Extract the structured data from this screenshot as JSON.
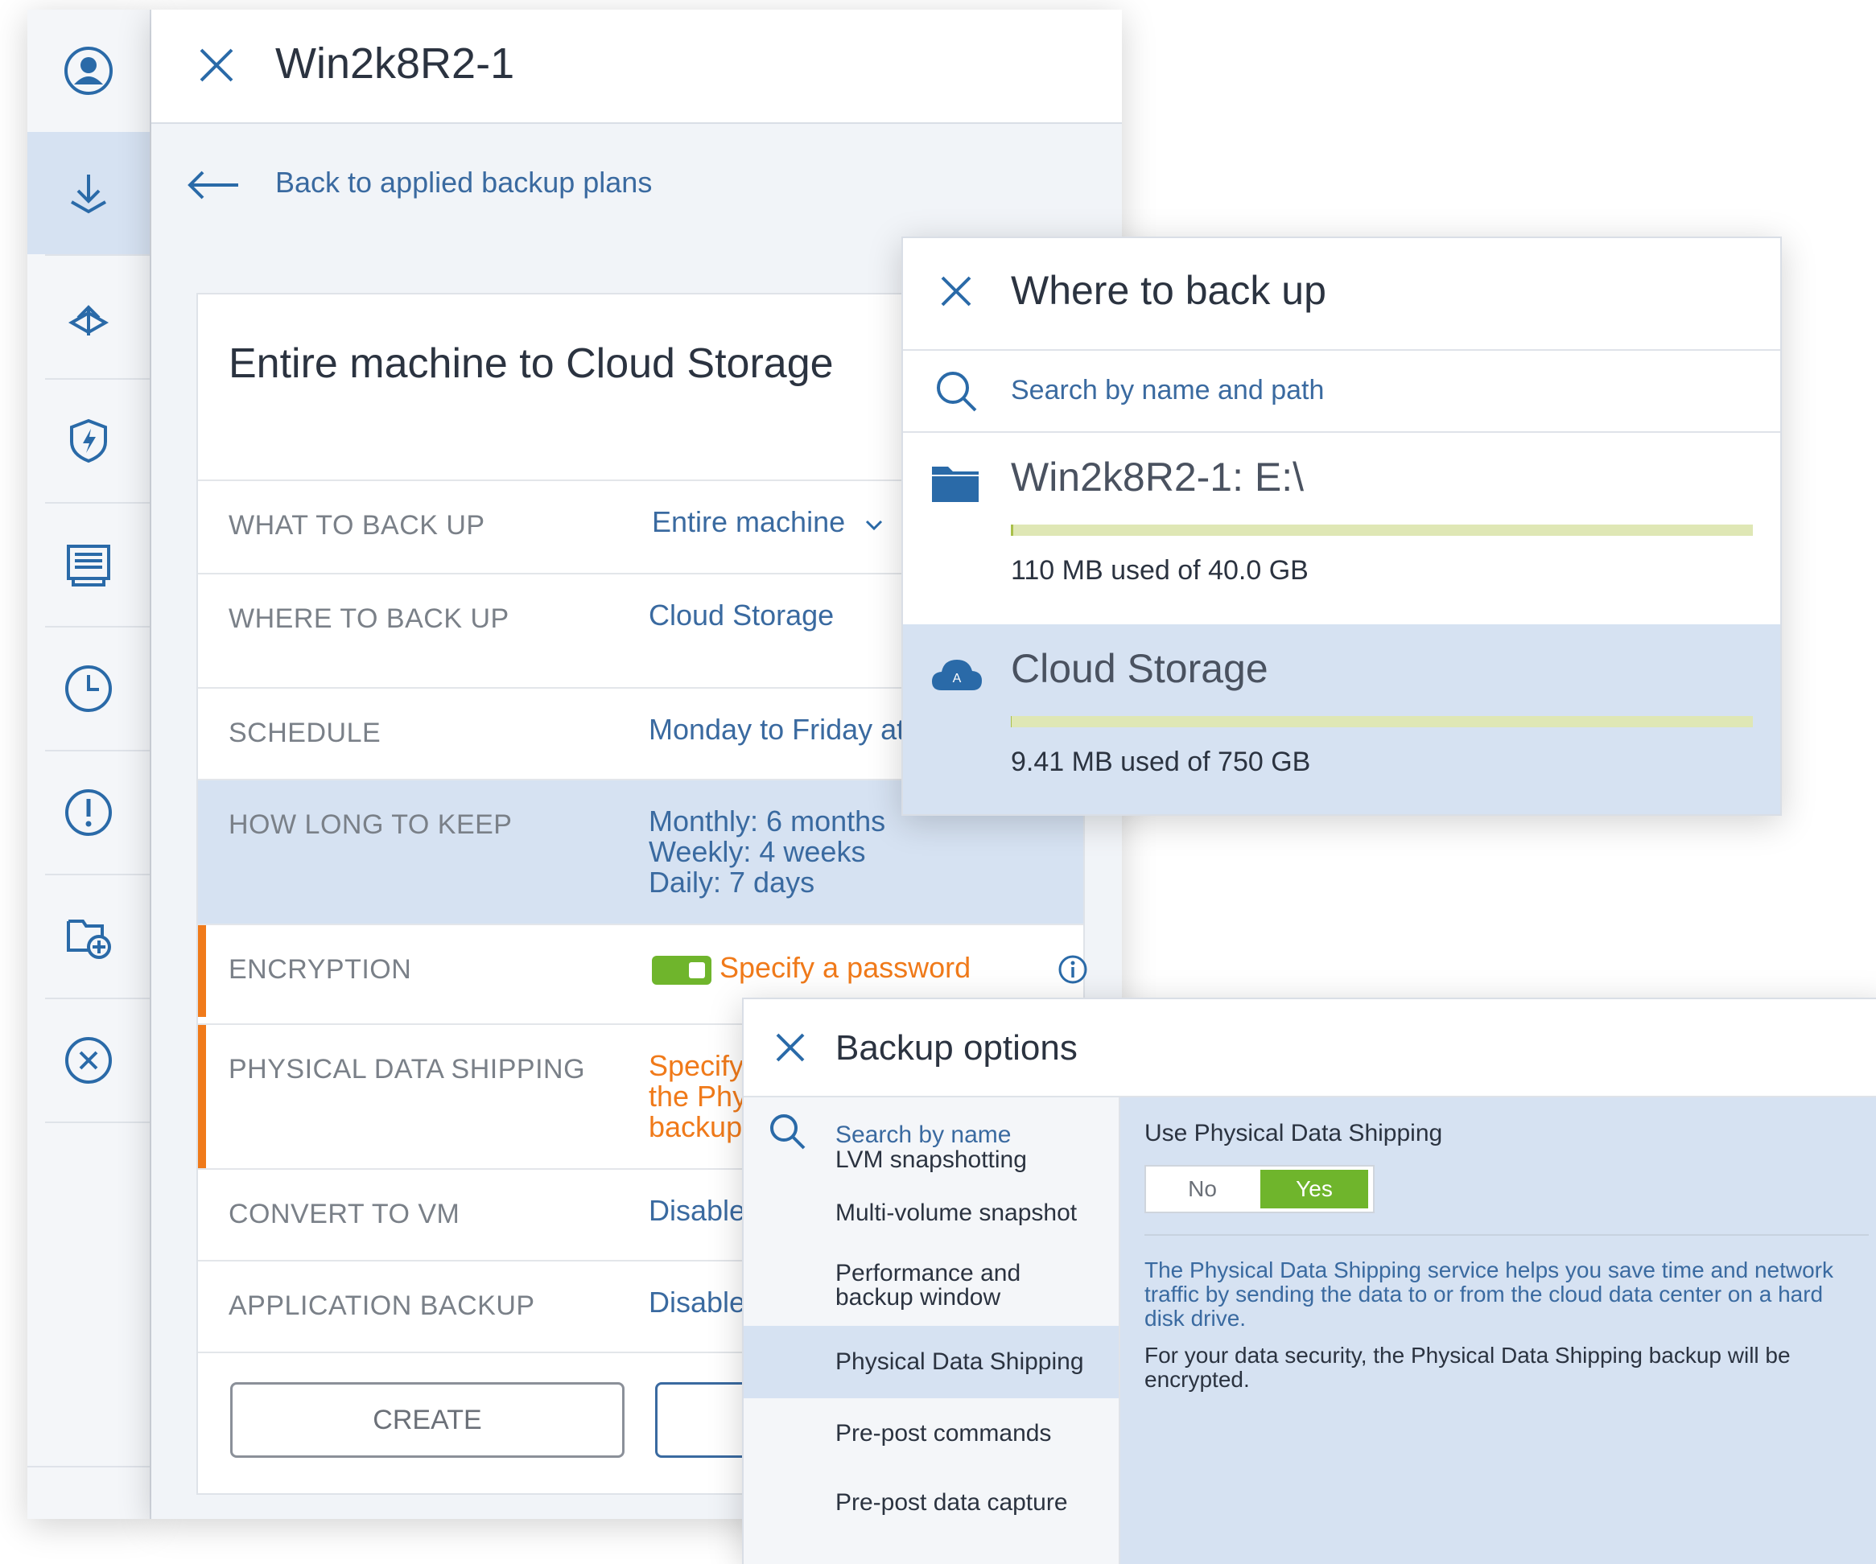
{
  "sidebar": {
    "icons": [
      "account-icon",
      "backup-download-icon",
      "recovery-icon",
      "protection-shield-icon",
      "reports-icon",
      "history-clock-icon",
      "alerts-icon",
      "add-device-icon",
      "cancel-icon"
    ]
  },
  "machine_panel": {
    "title": "Win2k8R2-1",
    "back_label": "Back to applied backup plans",
    "plan": {
      "title": "Entire machine to Cloud Storage",
      "rows": [
        {
          "label": "WHAT TO BACK UP",
          "value": "Entire machine"
        },
        {
          "label": "WHERE TO BACK UP",
          "value": "Cloud Storage"
        },
        {
          "label": "SCHEDULE",
          "value": "Monday to Friday at"
        },
        {
          "label": "HOW LONG TO KEEP",
          "lines": [
            "Monthly: 6 months",
            "Weekly: 4 weeks",
            "Daily: 7 days"
          ]
        },
        {
          "label": "ENCRYPTION",
          "value": "Specify a password"
        },
        {
          "label": "PHYSICAL DATA SHIPPING",
          "lines": [
            "Specify",
            "the Phy",
            "backup"
          ]
        },
        {
          "label": "CONVERT TO VM",
          "value": "Disable"
        },
        {
          "label": "APPLICATION BACKUP",
          "value": "Disable"
        }
      ],
      "create_label": "CREATE"
    }
  },
  "where_panel": {
    "title": "Where to back up",
    "search_placeholder": "Search by name and path",
    "locations": [
      {
        "name": "Win2k8R2-1: E:\\",
        "used": "110 MB used of 40.0 GB",
        "used_fraction": 0.003,
        "icon": "folder-icon"
      },
      {
        "name": "Cloud Storage",
        "used": "9.41 MB used of 750 GB",
        "used_fraction": 0.0001,
        "icon": "cloud-icon",
        "cloud_badge": "A"
      }
    ]
  },
  "options_panel": {
    "title": "Backup options",
    "search_placeholder": "Search by name",
    "items": [
      "LVM snapshotting",
      "Multi-volume snapshot",
      "Performance and backup window",
      "Physical Data Shipping",
      "Pre-post commands",
      "Pre-post data capture"
    ],
    "selected": "Physical Data Shipping",
    "detail": {
      "label": "Use Physical Data Shipping",
      "toggle_no": "No",
      "toggle_yes": "Yes",
      "description": "The Physical Data Shipping service helps you save time and network traffic by sending the data to or from the cloud data center on a hard disk drive.",
      "note": "For your data security, the Physical Data Shipping backup will be encrypted."
    }
  },
  "colors": {
    "accent_blue": "#3a6aa0",
    "selected_bg": "#d6e2f2",
    "warning_orange": "#f07a1a",
    "toggle_green": "#6fb52c"
  }
}
